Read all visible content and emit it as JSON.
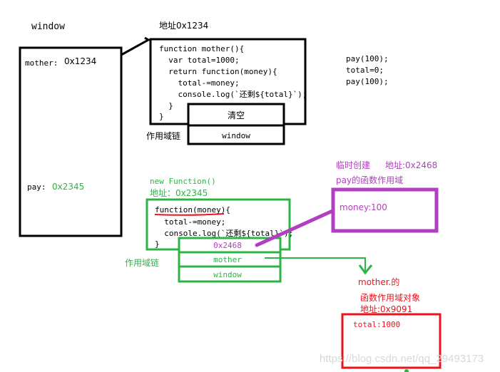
{
  "colors": {
    "black": "#000000",
    "green": "#2db446",
    "purple": "#b23fc0",
    "red": "#e8141e",
    "underline": "#e8141e"
  },
  "window": {
    "title": "window",
    "mother_label": "mother:",
    "mother_value": "0x1234",
    "pay_label": "pay:",
    "pay_value": "0x2345"
  },
  "mother_fn": {
    "address": "地址0x1234",
    "code": [
      "function mother(){",
      "  var total=1000;",
      "  return function(money){",
      "    total-=money;",
      "    console.log(`还剩${total}`);",
      "  }",
      "}"
    ],
    "chain_label": "作用域链",
    "chain": [
      "清空",
      "window"
    ]
  },
  "calls": [
    "pay(100);",
    "total=0;",
    "pay(100);"
  ],
  "pay_scope": {
    "created": "临时创建",
    "address": "地址:0x2468",
    "title": "pay的函数作用域",
    "money_label": "money:",
    "money_value": "100"
  },
  "inner_fn": {
    "title": "new Function()",
    "address": "地址：0x2345",
    "code": [
      "function(money){",
      "  total-=money;",
      "  console.log(`还剩${total}`);",
      "}"
    ],
    "chain_label": "作用域链",
    "chain": [
      "0x2468",
      "mother",
      "window"
    ]
  },
  "mother_scope": {
    "line1": "mother.的",
    "line2": "函数作用域对象",
    "address": "地址:0x9091",
    "content": "total:1000"
  },
  "watermark": "https://blog.csdn.net/qq_29493173"
}
